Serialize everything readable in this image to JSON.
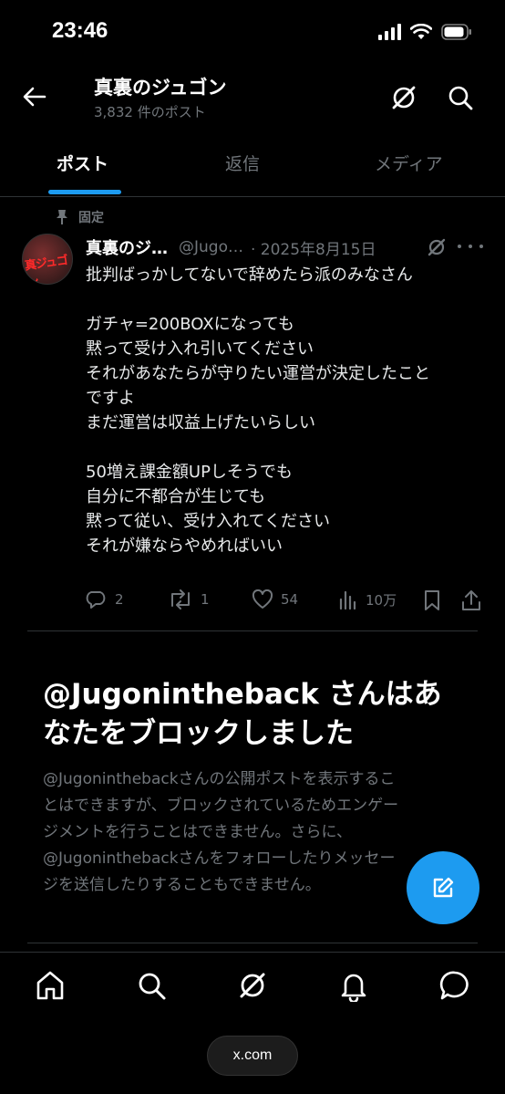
{
  "status_bar": {
    "time": "23:46"
  },
  "header": {
    "title": "真裏のジュゴン",
    "post_count": "3,832 件のポスト"
  },
  "tabs": [
    {
      "label": "ポスト",
      "active": true
    },
    {
      "label": "返信",
      "active": false
    },
    {
      "label": "メディア",
      "active": false
    }
  ],
  "pinned_label": "固定",
  "tweet": {
    "avatar_text": "真ジュゴン",
    "name": "真裏のジ…",
    "handle": "@Jugo…",
    "date": "· 2025年8月15日",
    "lines": [
      "批判ばっかしてないで辞めたら派のみなさん",
      "",
      "ガチャ=200BOXになっても",
      "黙って受け入れ引いてください",
      "それがあなたらが守りたい運営が決定したこと",
      "ですよ",
      "まだ運営は収益上げたいらしい",
      "",
      "50増え課金額UPしそうでも",
      "自分に不都合が生じても",
      "黙って従い、受け入れてください",
      "それが嫌ならやめればいい"
    ],
    "replies": "2",
    "reposts": "1",
    "likes": "54",
    "views": "10万"
  },
  "blocked": {
    "title_lines": [
      "@Jugonintheback さんはあ",
      "なたをブロックしました"
    ],
    "desc_lines": [
      "@Jugoninthebackさんの公開ポストを表示するこ",
      "とはできますが、ブロックされているためエンゲー",
      "ジメントを行うことはできません。さらに、",
      "@Jugoninthebackさんをフォローしたりメッセー",
      "ジを送信したりすることもできません。"
    ]
  },
  "url_bar": "x.com",
  "colors": {
    "accent": "#1d9bf0",
    "background": "#000000",
    "muted": "#71767b"
  }
}
